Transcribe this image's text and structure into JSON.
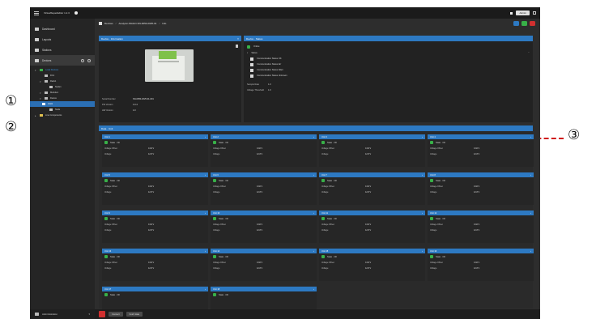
{
  "callouts": {
    "c1": "①",
    "c2": "②",
    "c3": "③"
  },
  "titlebar": {
    "app_title": "VirtualSuperEditor 1.2.3",
    "user_label": "Admin"
  },
  "sidebar": {
    "items": [
      {
        "label": "Dashboard"
      },
      {
        "label": "Layouts"
      },
      {
        "label": "Stations"
      },
      {
        "label": "Devices"
      }
    ],
    "tree": [
      {
        "label": "Local Devices"
      },
      {
        "label": "DC1"
      },
      {
        "label": "Rack1"
      },
      {
        "label": "Node1"
      },
      {
        "label": "Module1"
      },
      {
        "label": "Device"
      },
      {
        "label": "Unit1"
      },
      {
        "label": "Node"
      },
      {
        "label": "Line Components"
      }
    ],
    "bottom_label": "Administration"
  },
  "breadcrumb": {
    "items": [
      "Devices",
      "Analyzer-WAGO-SN-0050-2025-01",
      "Info"
    ],
    "status_colors": [
      "#2d79c2",
      "#38b048",
      "#d03030"
    ]
  },
  "info_panel": {
    "title": "Device · Information",
    "props": [
      {
        "key": "Serial Number",
        "value": "SN-0050-2025-01-001"
      },
      {
        "key": "FW Version",
        "value": "1.0.4"
      },
      {
        "key": "HW Version",
        "value": "1.0"
      }
    ]
  },
  "status_panel": {
    "title": "Device · Status",
    "state": "Online",
    "group_label": "Status",
    "options": [
      "Communication Status OK",
      "Communication Status Err",
      "Communication Status Warn",
      "Communication Status Unknown"
    ],
    "fields": [
      {
        "key": "Sample Rate",
        "value": "1.0"
      },
      {
        "key": "Voltage Threshold",
        "value": "1.0"
      }
    ]
  },
  "modules_panel": {
    "title": "Data · Unit"
  },
  "modules": [
    {
      "title": "Unit 1",
      "state": "State · OK",
      "v1": "0.02 V",
      "v2": "12.8 V"
    },
    {
      "title": "Unit 2",
      "state": "State · OK",
      "v1": "0.02 V",
      "v2": "12.8 V"
    },
    {
      "title": "Unit 3",
      "state": "State · OK",
      "v1": "0.02 V",
      "v2": "12.8 V"
    },
    {
      "title": "Unit 4",
      "state": "State · OK",
      "v1": "0.02 V",
      "v2": "12.8 V"
    },
    {
      "title": "Unit 5",
      "state": "State · OK",
      "v1": "0.02 V",
      "v2": "12.8 V"
    },
    {
      "title": "Unit 6",
      "state": "State · OK",
      "v1": "0.02 V",
      "v2": "12.8 V"
    },
    {
      "title": "Unit 7",
      "state": "State · OK",
      "v1": "0.02 V",
      "v2": "12.8 V"
    },
    {
      "title": "Unit 8",
      "state": "State · OK",
      "v1": "0.02 V",
      "v2": "12.8 V"
    },
    {
      "title": "Unit 9",
      "state": "State · OK",
      "v1": "0.02 V",
      "v2": "12.8 V"
    },
    {
      "title": "Unit 10",
      "state": "State · OK",
      "v1": "0.02 V",
      "v2": "12.8 V"
    },
    {
      "title": "Unit 11",
      "state": "State · OK",
      "v1": "0.02 V",
      "v2": "12.8 V"
    },
    {
      "title": "Unit 12",
      "state": "State · OK",
      "v1": "0.02 V",
      "v2": "12.8 V"
    },
    {
      "title": "Unit 13",
      "state": "State · OK",
      "v1": "0.02 V",
      "v2": "12.8 V"
    },
    {
      "title": "Unit 14",
      "state": "State · OK",
      "v1": "0.02 V",
      "v2": "12.8 V"
    },
    {
      "title": "Unit 15",
      "state": "State · OK",
      "v1": "0.02 V",
      "v2": "12.8 V"
    },
    {
      "title": "Unit 16",
      "state": "State · OK",
      "v1": "0.02 V",
      "v2": "12.8 V"
    },
    {
      "title": "Unit 17",
      "state": "State · OK"
    },
    {
      "title": "Unit 18",
      "state": "State · OK"
    }
  ],
  "module_labels": {
    "k1": "Voltage Offset",
    "k2": "Voltage"
  },
  "footer": {
    "btn1": "Connect",
    "btn2": "Fetch data"
  }
}
